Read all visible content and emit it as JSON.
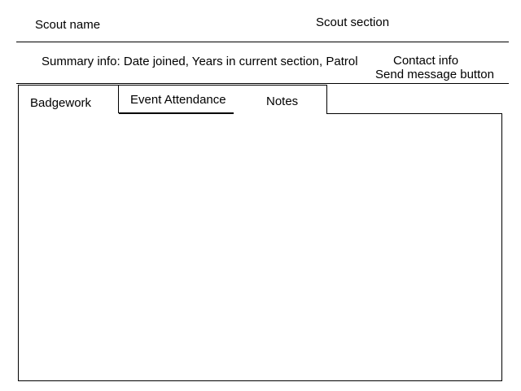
{
  "header": {
    "scout_name": "Scout name",
    "scout_section": "Scout section"
  },
  "summary": {
    "text": "Summary info:  Date joined,  Years in current section, Patrol",
    "contact_info": "Contact info",
    "send_message_button": "Send message button"
  },
  "tabs": [
    {
      "label": "Badgework"
    },
    {
      "label": "Event Attendance"
    },
    {
      "label": "Notes"
    }
  ],
  "active_tab": "Event Attendance"
}
